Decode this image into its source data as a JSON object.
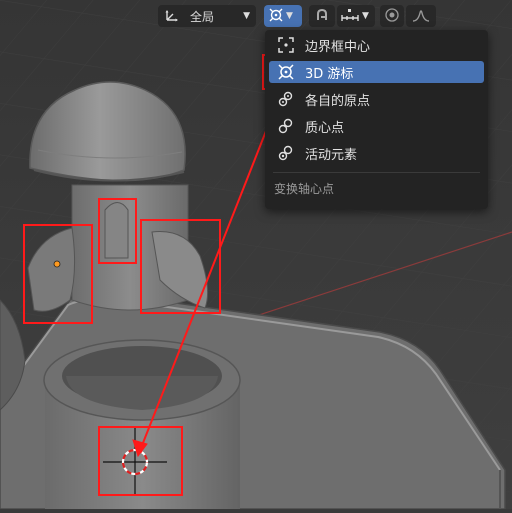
{
  "toolbar": {
    "transform_orientation": {
      "label": "全局",
      "icon": "transform-orientation-icon"
    },
    "pivot_point": {
      "icon": "cursor-3d-icon",
      "active": true
    },
    "snapping": {
      "icon": "snap-magnet-icon"
    },
    "snap_target": {
      "icon": "snap-increment-icon"
    },
    "proportional_editing": {
      "icon": "proportional-edit-icon"
    },
    "falloff": {
      "icon": "falloff-curve-icon"
    }
  },
  "pivot_menu": {
    "title": "变换轴心点",
    "items": [
      {
        "label": "边界框中心",
        "icon": "bounding-box-center-icon",
        "selected": false
      },
      {
        "label": "3D 游标",
        "icon": "cursor-3d-icon",
        "selected": true
      },
      {
        "label": "各自的原点",
        "icon": "individual-origins-icon",
        "selected": false
      },
      {
        "label": "质心点",
        "icon": "median-point-icon",
        "selected": false
      },
      {
        "label": "活动元素",
        "icon": "active-element-icon",
        "selected": false
      }
    ]
  },
  "colors": {
    "accent": "#4772b3",
    "annotation": "#ff1a1a",
    "menu_bg": "#232323",
    "viewport_bg": "#3a3a3a"
  }
}
